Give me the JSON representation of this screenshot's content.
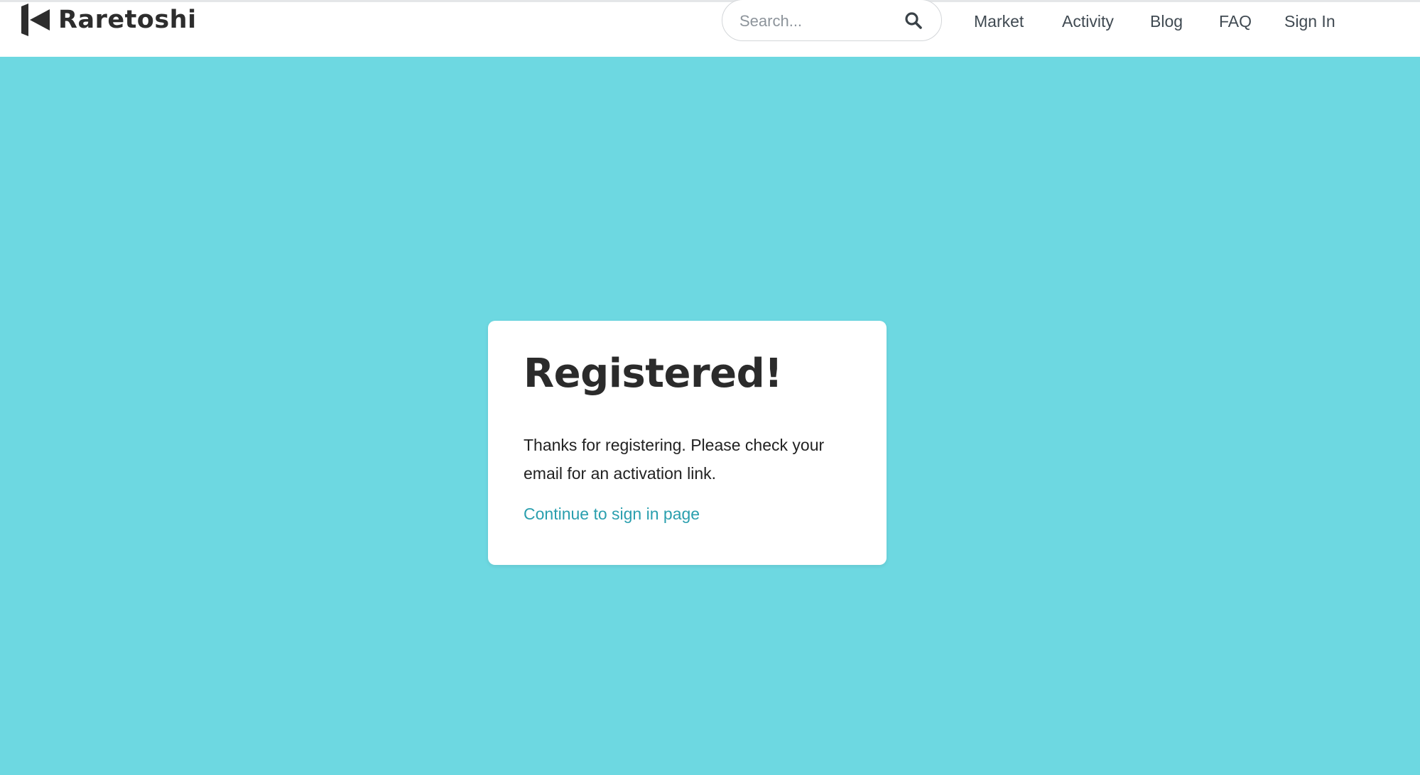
{
  "brand": {
    "name": "Raretoshi",
    "logo_icon": "raretoshi-logo-icon"
  },
  "search": {
    "placeholder": "Search...",
    "value": "",
    "icon": "search-icon"
  },
  "nav": {
    "items": [
      {
        "label": "Market"
      },
      {
        "label": "Activity"
      },
      {
        "label": "Blog"
      },
      {
        "label": "FAQ"
      },
      {
        "label": "Sign In"
      }
    ]
  },
  "card": {
    "title": "Registered!",
    "message": "Thanks for registering. Please check your email for an activation link.",
    "link_label": "Continue to sign in page"
  },
  "colors": {
    "background": "#6dd8e1",
    "link": "#2a9fae",
    "text_dark": "#2b2b2b"
  }
}
